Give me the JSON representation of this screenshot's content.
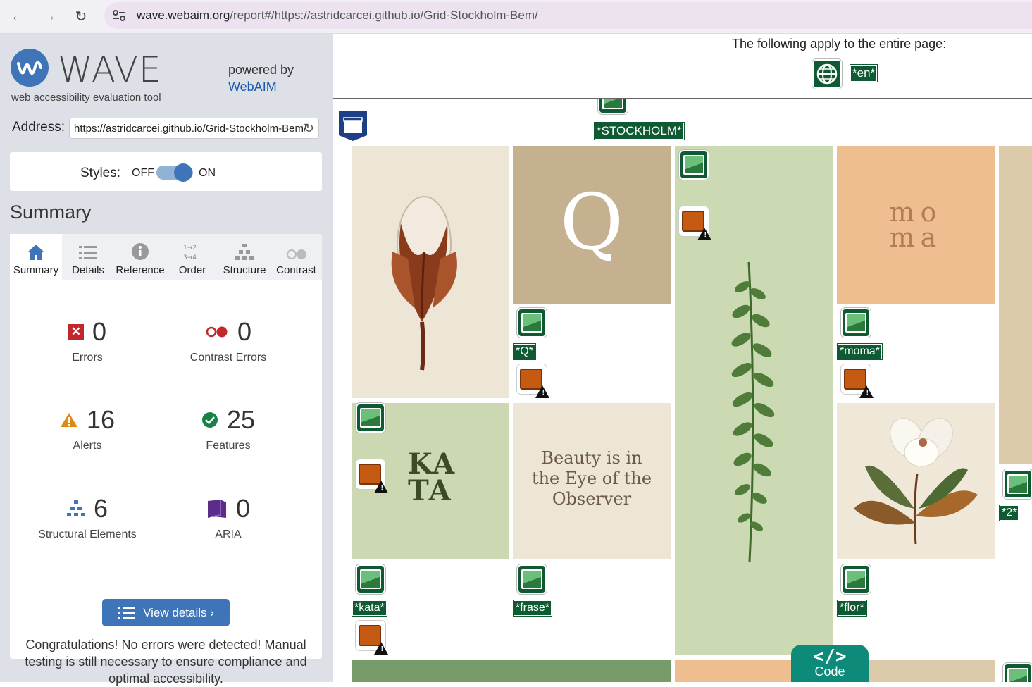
{
  "browser": {
    "url_host": "wave.webaim.org",
    "url_path": "/report#/https://astridcarcei.github.io/Grid-Stockholm-Bem/"
  },
  "sidebar": {
    "title": "WAVE",
    "tagline": "web accessibility evaluation tool",
    "powered_by": "powered by",
    "webaim_link": "WebAIM",
    "address_label": "Address:",
    "address_value": "https://astridcarcei.github.io/Grid-Stockholm-Bem/",
    "styles_label": "Styles:",
    "styles_off": "OFF",
    "styles_on": "ON",
    "styles_state": "on",
    "summary_title": "Summary",
    "tabs": [
      {
        "label": "Summary",
        "icon": "home-icon",
        "active": true
      },
      {
        "label": "Details",
        "icon": "list-icon",
        "active": false
      },
      {
        "label": "Reference",
        "icon": "info-icon",
        "active": false
      },
      {
        "label": "Order",
        "icon": "order-icon",
        "active": false
      },
      {
        "label": "Structure",
        "icon": "structure-icon",
        "active": false
      },
      {
        "label": "Contrast",
        "icon": "contrast-icon",
        "active": false
      }
    ],
    "stats": {
      "errors": {
        "value": "0",
        "label": "Errors"
      },
      "contrast_errors": {
        "value": "0",
        "label": "Contrast Errors"
      },
      "alerts": {
        "value": "16",
        "label": "Alerts"
      },
      "features": {
        "value": "25",
        "label": "Features"
      },
      "structural": {
        "value": "6",
        "label": "Structural Elements"
      },
      "aria": {
        "value": "0",
        "label": "ARIA"
      }
    },
    "view_details": "View details ›",
    "congrats": "Congratulations! No errors were detected! Manual testing is still necessary to ensure compliance and optimal accessibility."
  },
  "content": {
    "apply_text": "The following apply to the entire page:",
    "lang_label": "*en*",
    "labels": {
      "stockholm": "*STOCKHOLM*",
      "q": "*Q*",
      "moma": "*moma*",
      "two": "*2*",
      "kata": "*kata*",
      "frase": "*frase*",
      "flor": "*flor*"
    },
    "tiles": {
      "q_letter": "Q",
      "moma_line1": "mo",
      "moma_line2": "ma",
      "kata_line1": "KA",
      "kata_line2": "TA",
      "quote": "Beauty is in the Eye of the Observer"
    },
    "code_button": "Code",
    "code_glyph": "</>"
  },
  "colors": {
    "wave_blue": "#3f74b9",
    "feature_green": "#0e5a32",
    "alert_orange": "#c55b12",
    "sidebar_bg": "#dde0e6"
  }
}
